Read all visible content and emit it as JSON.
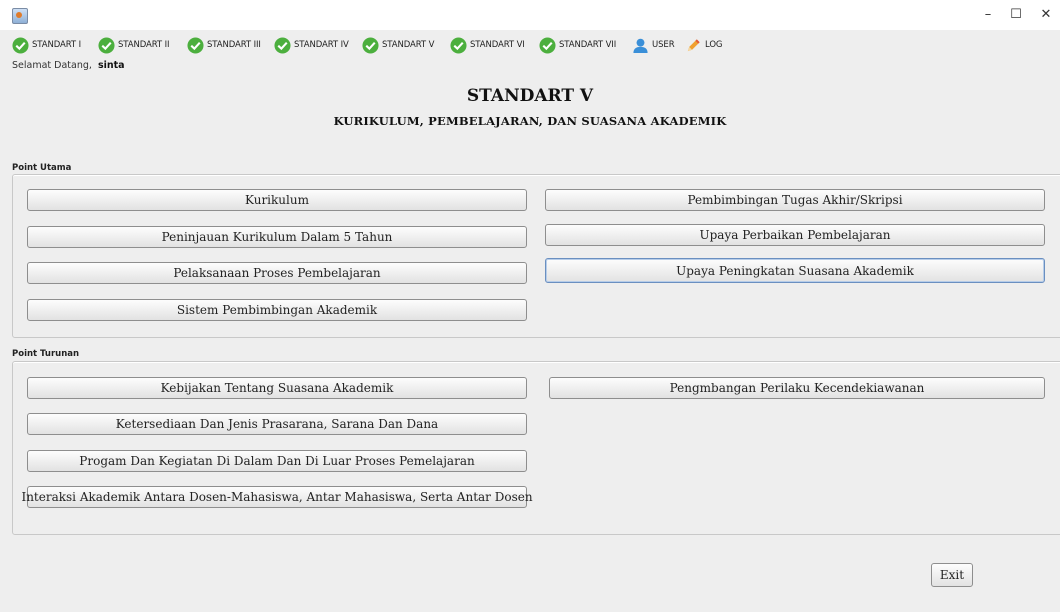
{
  "window": {
    "minimize": "–",
    "maximize": "☐",
    "close": "✕"
  },
  "menu": [
    {
      "label": "STANDART I",
      "icon": "check-icon"
    },
    {
      "label": "STANDART II",
      "icon": "check-icon"
    },
    {
      "label": "STANDART III",
      "icon": "check-icon"
    },
    {
      "label": "STANDART IV",
      "icon": "check-icon"
    },
    {
      "label": "STANDART V",
      "icon": "check-icon"
    },
    {
      "label": "STANDART VI",
      "icon": "check-icon"
    },
    {
      "label": "STANDART VII",
      "icon": "check-icon"
    },
    {
      "label": "USER",
      "icon": "user-icon"
    },
    {
      "label": "LOG",
      "icon": "pencil-icon"
    }
  ],
  "welcome": {
    "text": "Selamat Datang,",
    "user": "sinta"
  },
  "header": {
    "title": "STANDART V",
    "subtitle": "KURIKULUM, PEMBELAJARAN, DAN SUASANA AKADEMIK"
  },
  "point_utama": {
    "label": "Point Utama",
    "left": [
      "Kurikulum",
      "Peninjauan Kurikulum Dalam 5 Tahun",
      "Pelaksanaan Proses Pembelajaran",
      "Sistem Pembimbingan Akademik"
    ],
    "right": [
      "Pembimbingan Tugas Akhir/Skripsi",
      "Upaya Perbaikan Pembelajaran",
      "Upaya Peningkatan Suasana Akademik"
    ]
  },
  "point_turunan": {
    "label": "Point Turunan",
    "left": [
      "Kebijakan Tentang Suasana Akademik",
      "Ketersediaan Dan Jenis Prasarana, Sarana Dan Dana",
      "Progam Dan Kegiatan Di Dalam Dan Di Luar Proses Pemelajaran",
      "Interaksi Akademik Antara Dosen-Mahasiswa, Antar Mahasiswa, Serta Antar Dosen"
    ],
    "right": [
      "Pengmbangan Perilaku Kecendekiawanan"
    ]
  },
  "exit_label": "Exit",
  "colors": {
    "check_green": "#4caf3e",
    "user_blue": "#3a8fd8",
    "pencil_orange": "#f0a030"
  }
}
